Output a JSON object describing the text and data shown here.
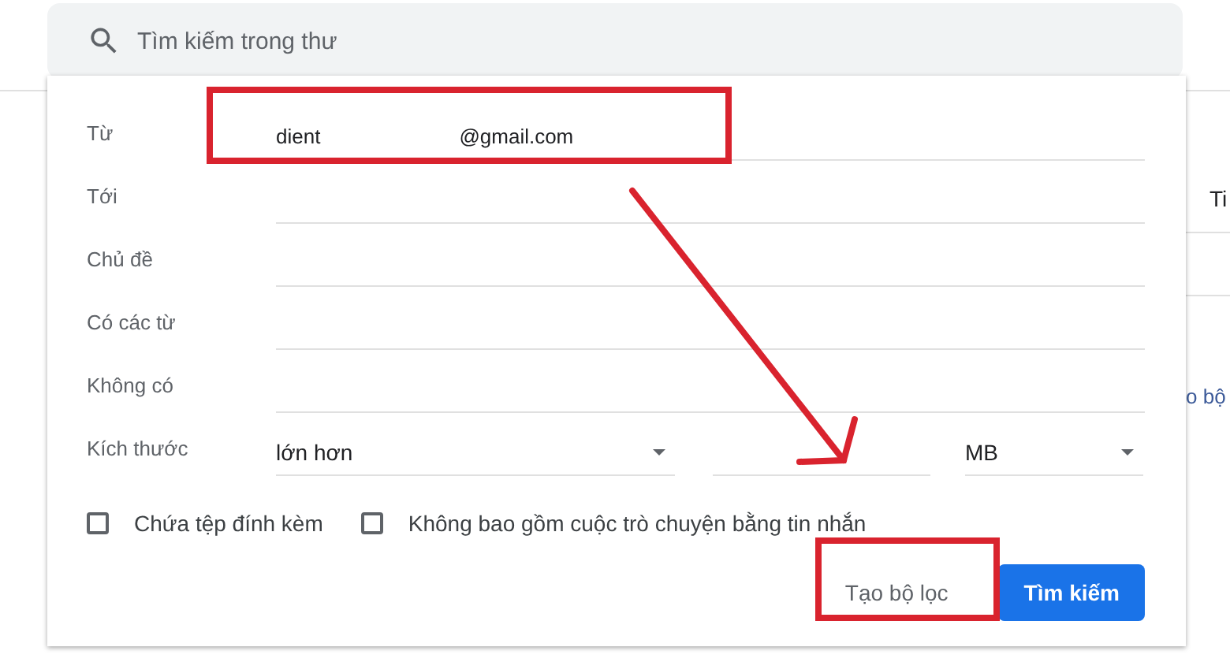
{
  "search": {
    "placeholder": "Tìm kiếm trong thư"
  },
  "background": {
    "column_header": "Ti",
    "link": "o bộ"
  },
  "fields": [
    {
      "label": "Từ",
      "value_parts": [
        "dient",
        "@gmail.com"
      ]
    },
    {
      "label": "Tới"
    },
    {
      "label": "Chủ đề"
    },
    {
      "label": "Có các từ"
    },
    {
      "label": "Không có"
    }
  ],
  "size": {
    "label": "Kích thước",
    "comparison": "lớn hơn",
    "unit": "MB"
  },
  "checkboxes": [
    {
      "label": "Chứa tệp đính kèm",
      "checked": false
    },
    {
      "label": "Không bao gồm cuộc trò chuyện bằng tin nhắn",
      "checked": false
    }
  ],
  "buttons": [
    {
      "label": "Tạo bộ lọc",
      "kind": "text"
    },
    {
      "label": "Tìm kiếm",
      "kind": "primary"
    }
  ]
}
